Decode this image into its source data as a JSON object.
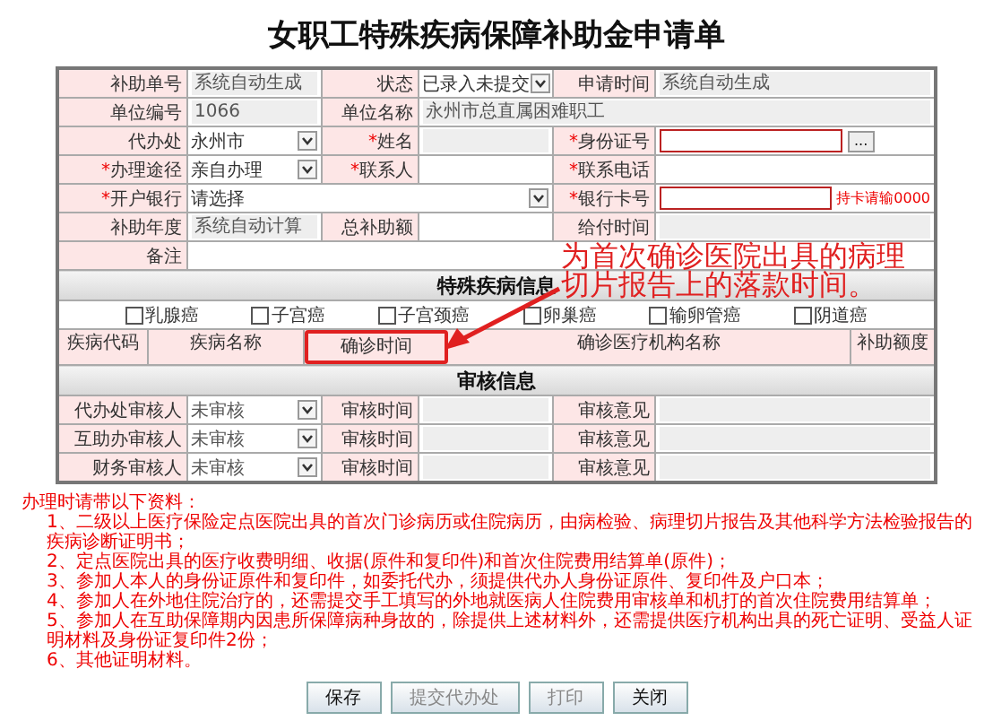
{
  "title": "女职工特殊疾病保障补助金申请单",
  "form": {
    "rows": [
      [
        {
          "kind": "label",
          "text": "补助单号"
        },
        {
          "kind": "readonly",
          "value": "系统自动生成"
        },
        {
          "kind": "label",
          "text": "状态"
        },
        {
          "kind": "select",
          "value": "已录入未提交"
        },
        {
          "kind": "label",
          "text": "申请时间"
        },
        {
          "kind": "readonly",
          "value": "系统自动生成"
        }
      ],
      [
        {
          "kind": "label",
          "text": "单位编号"
        },
        {
          "kind": "readonly",
          "value": "1066"
        },
        {
          "kind": "label",
          "text": "单位名称"
        },
        {
          "kind": "readonly",
          "value": "永州市总直属困难职工",
          "colspan": 3
        }
      ],
      [
        {
          "kind": "label",
          "text": "代办处"
        },
        {
          "kind": "select",
          "value": "永州市"
        },
        {
          "kind": "label",
          "text": "姓名",
          "mark": "*"
        },
        {
          "kind": "readonly"
        },
        {
          "kind": "label",
          "text": "身份证号",
          "mark": "*"
        },
        {
          "kind": "input",
          "invalid": true,
          "button": "..."
        }
      ],
      [
        {
          "kind": "label",
          "text": "办理途径",
          "mark": "*"
        },
        {
          "kind": "select",
          "value": "亲自办理"
        },
        {
          "kind": "label",
          "text": "联系人",
          "mark": "*"
        },
        {
          "kind": "blank"
        },
        {
          "kind": "label",
          "text": "联系电话",
          "mark": "*"
        },
        {
          "kind": "blank"
        }
      ],
      [
        {
          "kind": "label",
          "text": "开户银行",
          "mark": "*"
        },
        {
          "kind": "select",
          "value": "请选择",
          "colspan": 3
        },
        {
          "kind": "label",
          "text": "银行卡号",
          "mark": "*"
        },
        {
          "kind": "input",
          "invalid": true,
          "hint": "持卡请输0000"
        }
      ],
      [
        {
          "kind": "label",
          "text": "补助年度"
        },
        {
          "kind": "readonly",
          "value": "系统自动计算"
        },
        {
          "kind": "label",
          "text": "总补助额"
        },
        {
          "kind": "blank"
        },
        {
          "kind": "label",
          "text": "给付时间"
        },
        {
          "kind": "readonly"
        }
      ],
      [
        {
          "kind": "label",
          "text": "备注"
        },
        {
          "kind": "blank",
          "colspan": 5
        }
      ]
    ]
  },
  "disease_section": {
    "title": "特殊疾病信息",
    "options": [
      {
        "label": "乳腺癌",
        "checked": false
      },
      {
        "label": "子宫癌",
        "checked": false
      },
      {
        "label": "子宫颈癌",
        "checked": false
      },
      {
        "label": "卵巢癌",
        "checked": false
      },
      {
        "label": "输卵管癌",
        "checked": false
      },
      {
        "label": "阴道癌",
        "checked": false
      }
    ],
    "columns": [
      {
        "label": "疾病代码",
        "highlighted": false
      },
      {
        "label": "疾病名称",
        "highlighted": false
      },
      {
        "label": "确诊时间",
        "highlighted": true
      },
      {
        "label": "确诊医疗机构名称",
        "highlighted": false
      },
      {
        "label": "补助额度",
        "highlighted": false
      }
    ]
  },
  "review_section": {
    "title": "审核信息",
    "rows": [
      {
        "reviewer_label": "代办处审核人",
        "status": "未审核",
        "time_label": "审核时间",
        "opinion_label": "审核意见"
      },
      {
        "reviewer_label": "互助办审核人",
        "status": "未审核",
        "time_label": "审核时间",
        "opinion_label": "审核意见"
      },
      {
        "reviewer_label": "财务审核人",
        "status": "未审核",
        "time_label": "审核时间",
        "opinion_label": "审核意见"
      }
    ]
  },
  "notes": {
    "heading": "办理时请带以下资料：",
    "items": [
      "1、二级以上医疗保险定点医院出具的首次门诊病历或住院病历，由病检验、病理切片报告及其他科学方法检验报告的疾病诊断证明书；",
      "2、定点医院出具的医疗收费明细、收据(原件和复印件)和首次住院费用结算单(原件)；",
      "3、参加人本人的身份证原件和复印件，如委托代办，须提供代办人身份证原件、复印件及户口本；",
      "4、参加人在外地住院治疗的，还需提交手工填写的外地就医病人住院费用审核单和机打的首次住院费用结算单；",
      "5、参加人在互助保障期内因患所保障病种身故的，除提供上述材料外，还需提供医疗机构出具的死亡证明、受益人证明材料及身份证复印件2份；",
      "6、其他证明材料。"
    ]
  },
  "buttons": [
    {
      "label": "保存",
      "disabled": false
    },
    {
      "label": "提交代办处",
      "disabled": true
    },
    {
      "label": "打印",
      "disabled": true
    },
    {
      "label": "关闭",
      "disabled": false
    }
  ],
  "annotation": {
    "text": "为首次确诊医院出具的病理切片报告上的落款时间。"
  }
}
